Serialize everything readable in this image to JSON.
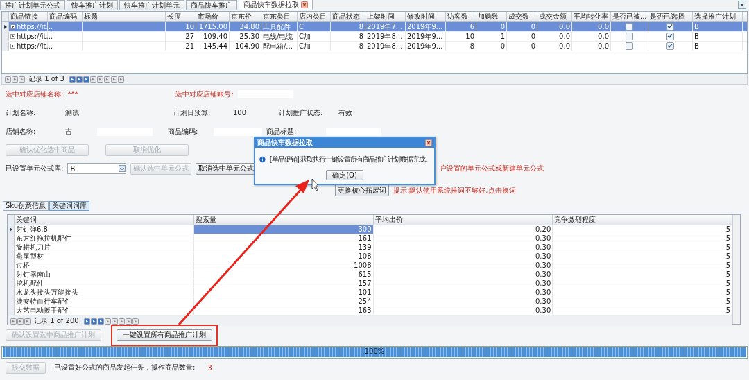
{
  "tabs": [
    {
      "label": "推广计划单元公式",
      "selected": false,
      "closable": false
    },
    {
      "label": "快车推广计划",
      "selected": false,
      "closable": false
    },
    {
      "label": "快车推广计划单元",
      "selected": false,
      "closable": false
    },
    {
      "label": "商品快车推广",
      "selected": false,
      "closable": false
    },
    {
      "label": "商品快车数据拉取",
      "selected": true,
      "closable": true
    }
  ],
  "product_grid": {
    "columns": [
      "商品链接",
      "商品编码",
      "标题",
      "长度",
      "市场价",
      "京东价",
      "京东类目",
      "店内类目",
      "商品状态",
      "上架时间",
      "修改时间",
      "访客数",
      "加购数",
      "成交数",
      "成交金额",
      "平均转化率",
      "是否已被...",
      "是否已选择",
      "选择推广计划"
    ],
    "rows": [
      {
        "selected": true,
        "link": "https://it...",
        "values": [
          "10",
          "1715.00",
          "34.80",
          "工具配件",
          "C",
          "8",
          "2019年7...",
          "2019年9...",
          "6",
          "0",
          "0",
          "0.0",
          "0.0"
        ],
        "flag_checked": false,
        "chosen_checked": true,
        "plan": "B"
      },
      {
        "selected": false,
        "link": "https://it...",
        "values": [
          "27",
          "109.40",
          "25.30",
          "电线/电缆",
          "C加",
          "8",
          "2019年8...",
          "2019年9...",
          "10",
          "1",
          "0",
          "0.0",
          "0.0"
        ],
        "flag_checked": false,
        "chosen_checked": true,
        "plan": "B"
      },
      {
        "selected": false,
        "link": "https://it...",
        "values": [
          "21",
          "145.44",
          "104.90",
          "配电箱/...",
          "C加",
          "8",
          "2019年8...",
          "2019年9...",
          "8",
          "0",
          "0",
          "0.0",
          "0.0"
        ],
        "flag_checked": false,
        "chosen_checked": true,
        "plan": "B"
      }
    ]
  },
  "product_pager": {
    "label": "记录 1 of 3"
  },
  "form": {
    "shop_name_label": "选中对应店铺名称:",
    "shop_name_value": "***",
    "shop_account_label": "选中对应店铺账号:",
    "plan_name_label": "计划名称:",
    "plan_name_value": "测试",
    "budget_label": "计划日预算:",
    "budget_value": "100",
    "status_label": "计划推广状态:",
    "status_value": "有效",
    "store_label": "店铺名称:",
    "store_value": "吉",
    "code_label": "商品编码:",
    "title_label": "商品标题:",
    "confirm_opt": {
      "label": "确认优化选中商品",
      "disabled": true
    },
    "cancel_opt": {
      "label": "取消优化",
      "disabled": true
    },
    "formula_label": "已设置单元公式库:",
    "formula_value": "B",
    "confirm_formula": {
      "label": "确认选中单元公式",
      "disabled": true
    },
    "cancel_formula": {
      "label": "取消选中单元公式",
      "disabled": false
    },
    "formula_hint": "户设置的单元公式或新建单元公式",
    "swap_button": "更换核心拓展词",
    "swap_hint": "提示:默认使用系统推词不够好,点击换词"
  },
  "lower_tabs": [
    {
      "label": "Sku创意信息",
      "selected": false
    },
    {
      "label": "关键词词库",
      "selected": true
    }
  ],
  "keyword_grid": {
    "columns": [
      "关键词",
      "搜索量",
      "平均出价",
      "竞争激烈程度"
    ],
    "rows": [
      {
        "selected": true,
        "cells": [
          "射钉弹6.8",
          "300",
          "0.20",
          "5"
        ]
      },
      {
        "selected": false,
        "cells": [
          "东方红拖拉机配件",
          "161",
          "0.30",
          "5"
        ]
      },
      {
        "selected": false,
        "cells": [
          "旋耕机刀片",
          "139",
          "0.30",
          "5"
        ]
      },
      {
        "selected": false,
        "cells": [
          "燕尾型材",
          "108",
          "0.30",
          "5"
        ]
      },
      {
        "selected": false,
        "cells": [
          "过桥",
          "1008",
          "0.30",
          "5"
        ]
      },
      {
        "selected": false,
        "cells": [
          "射钉器南山",
          "615",
          "0.30",
          "5"
        ]
      },
      {
        "selected": false,
        "cells": [
          "挖机配件",
          "157",
          "0.30",
          "5"
        ]
      },
      {
        "selected": false,
        "cells": [
          "水龙头接头万能接头",
          "101",
          "0.30",
          "5"
        ]
      },
      {
        "selected": false,
        "cells": [
          "捷安特自行车配件",
          "254",
          "0.30",
          "5"
        ]
      },
      {
        "selected": false,
        "cells": [
          "大艺电动扳手配件",
          "163",
          "0.30",
          "5"
        ]
      }
    ]
  },
  "keyword_pager": {
    "label": "记录 1 of 200"
  },
  "set_selected_button": {
    "label": "确认设置选中商品推广计划",
    "disabled": true
  },
  "set_all_button": {
    "label": "一键设置所有商品推广计划",
    "disabled": false
  },
  "progress": {
    "level": 1,
    "reading": "100%"
  },
  "submit_button": {
    "label": "提交数据",
    "disabled": true
  },
  "footer_text": "已设置好公式的商品发起任务，操作商品数量:",
  "footer_count": "3",
  "dialog": {
    "title": "商品快车数据拉取",
    "message": "[单品促销]:获取执行一键设置所有商品推广计划数据完成。",
    "ok": "确定(O)"
  }
}
